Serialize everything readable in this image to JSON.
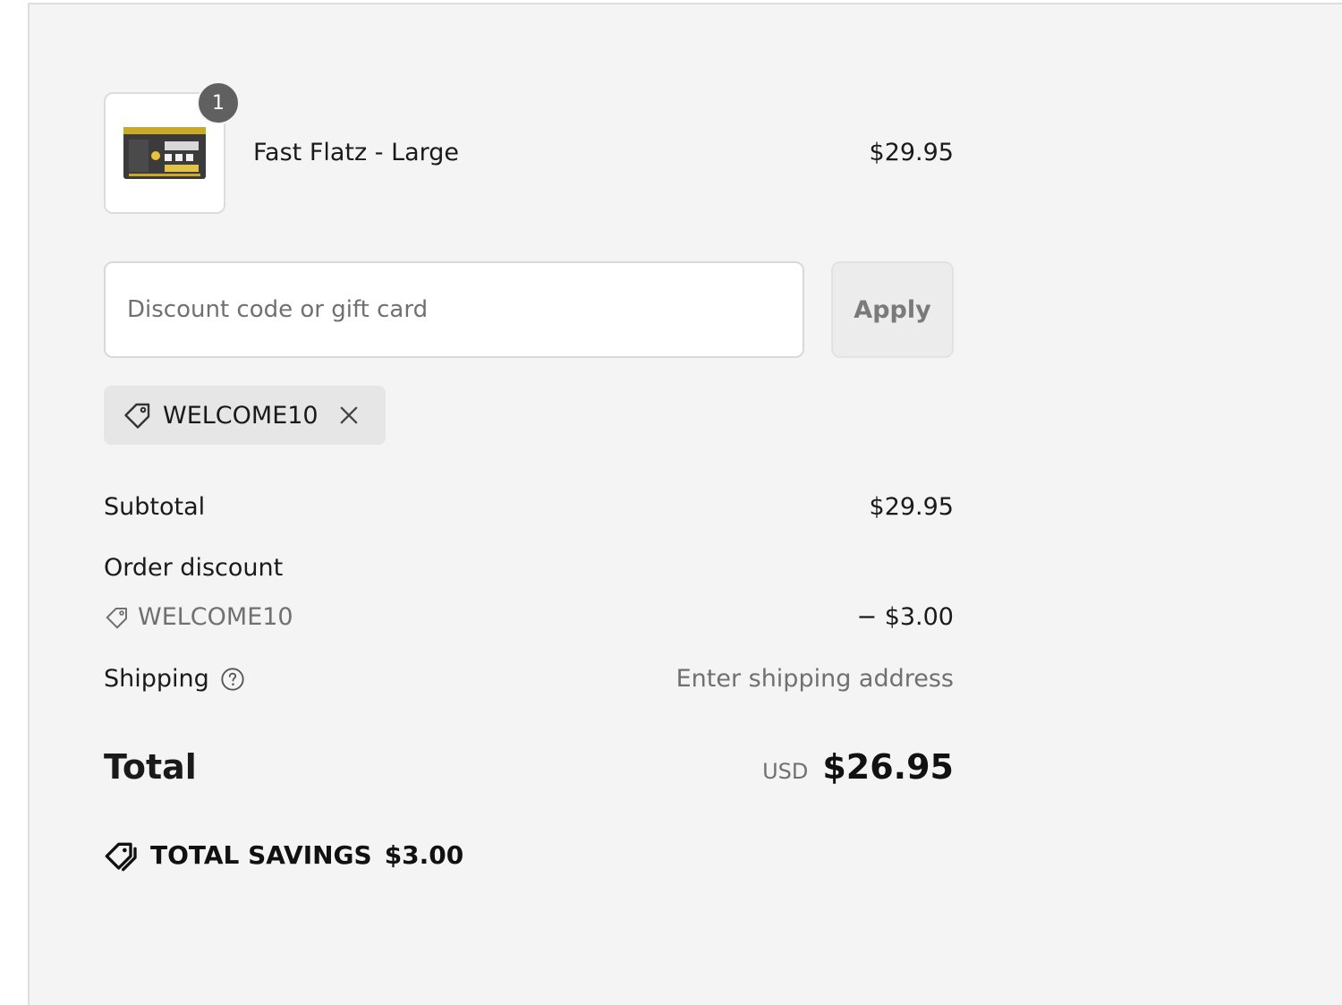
{
  "line_item": {
    "quantity": "1",
    "name": "Fast Flatz - Large",
    "price": "$29.95"
  },
  "discount_form": {
    "placeholder": "Discount code or gift card",
    "apply_label": "Apply"
  },
  "applied_code": {
    "code": "WELCOME10"
  },
  "totals": {
    "subtotal_label": "Subtotal",
    "subtotal_value": "$29.95",
    "order_discount_label": "Order discount",
    "discount_code": "WELCOME10",
    "discount_value": "− $3.00",
    "shipping_label": "Shipping",
    "shipping_value": "Enter shipping address",
    "total_label": "Total",
    "currency": "USD",
    "total_value": "$26.95"
  },
  "savings": {
    "label": "TOTAL SAVINGS",
    "amount": "$3.00"
  },
  "icons": {
    "tag": "tag-icon",
    "close": "close-icon",
    "help": "question-circle-icon",
    "savings": "double-tag-icon"
  },
  "colors": {
    "panel_bg": "#f4f4f4",
    "badge_bg": "#606060",
    "muted_text": "#707070"
  }
}
